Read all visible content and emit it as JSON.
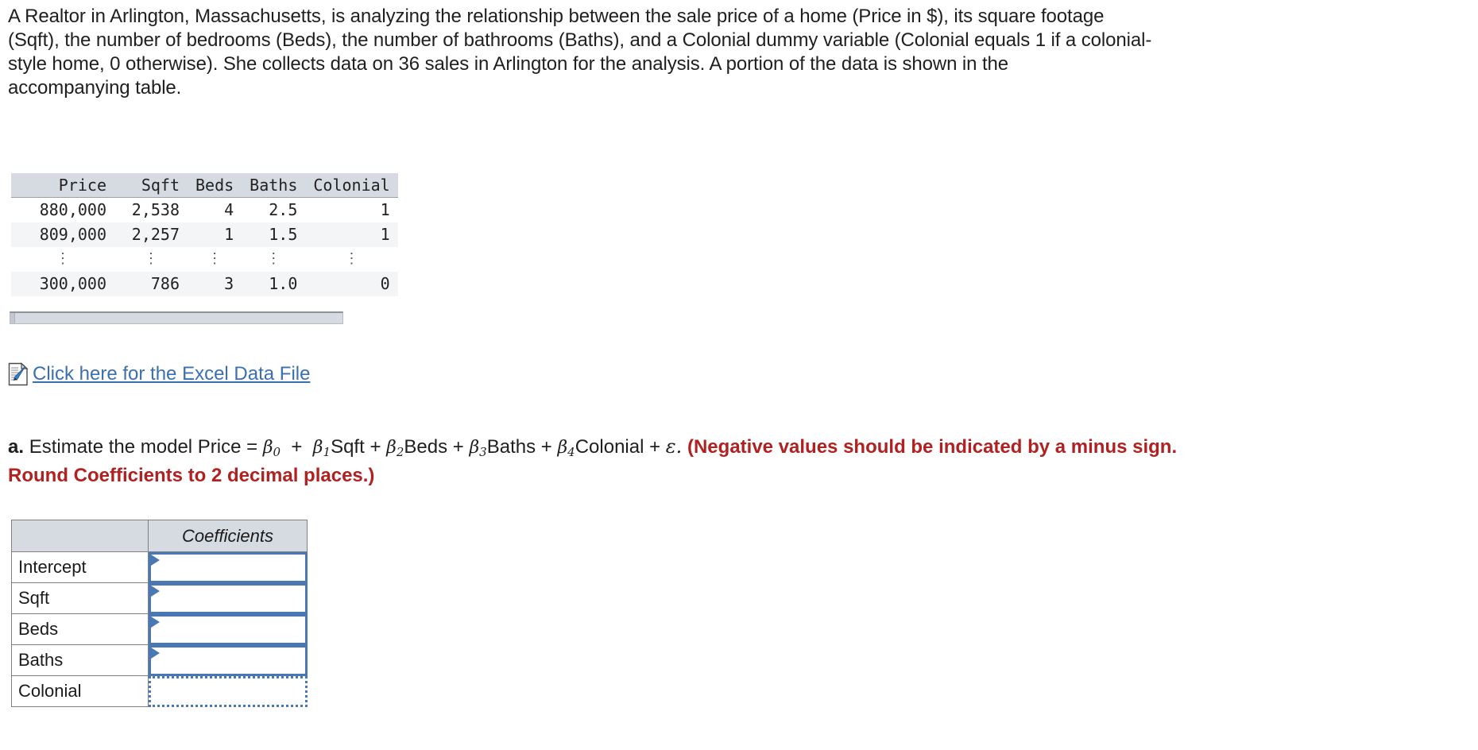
{
  "statement": {
    "text": "A Realtor in Arlington, Massachusetts, is analyzing the relationship between the sale price of a home (Price in $), its square footage\n(Sqft), the number of bedrooms (Beds), the number of bathrooms (Baths), and a Colonial dummy variable (Colonial equals 1 if a colonial-\nstyle home, 0 otherwise). She collects data on 36 sales in Arlington for the analysis. A portion of the data is shown in the\naccompanying table."
  },
  "data_table": {
    "headers": [
      "Price",
      "Sqft",
      "Beds",
      "Baths",
      "Colonial"
    ],
    "rows": [
      [
        "880,000",
        "2,538",
        "4",
        "2.5",
        "1"
      ],
      [
        "809,000",
        "2,257",
        "1",
        "1.5",
        "1"
      ],
      [
        "⋮",
        "⋮",
        "⋮",
        "⋮",
        "⋮"
      ],
      [
        "300,000",
        "786",
        "3",
        "1.0",
        "0"
      ]
    ]
  },
  "excel_link": {
    "label": "Click here for the Excel Data File",
    "icon": "excel-document-icon"
  },
  "part_a": {
    "marker": "a.",
    "prompt_before": "Estimate the model Price =",
    "terms": [
      {
        "beta": "β",
        "sub": "0",
        "var": ""
      },
      {
        "beta": "β",
        "sub": "1",
        "var": "Sqft"
      },
      {
        "beta": "β",
        "sub": "2",
        "var": "Beds"
      },
      {
        "beta": "β",
        "sub": "3",
        "var": "Baths"
      },
      {
        "beta": "β",
        "sub": "4",
        "var": "Colonial"
      }
    ],
    "error_term": "ε.",
    "instruction_line1": "(Negative values should be indicated by a minus sign.",
    "instruction_line2": "Round Coefficients to 2 decimal places.)",
    "instruction_color": "#b02222"
  },
  "coefficients_table": {
    "header_blank": "",
    "header_value": "Coefficients",
    "rows": [
      {
        "label": "Intercept",
        "value": "",
        "state": "normal"
      },
      {
        "label": "Sqft",
        "value": "",
        "state": "normal"
      },
      {
        "label": "Beds",
        "value": "",
        "state": "normal"
      },
      {
        "label": "Baths",
        "value": "",
        "state": "normal"
      },
      {
        "label": "Colonial",
        "value": "",
        "state": "focused"
      }
    ],
    "input_border_color": "#4a78b5",
    "header_bg": "#d6dae1"
  },
  "scrollbar": {
    "orientation": "horizontal",
    "track_color": "#d6dae1"
  }
}
